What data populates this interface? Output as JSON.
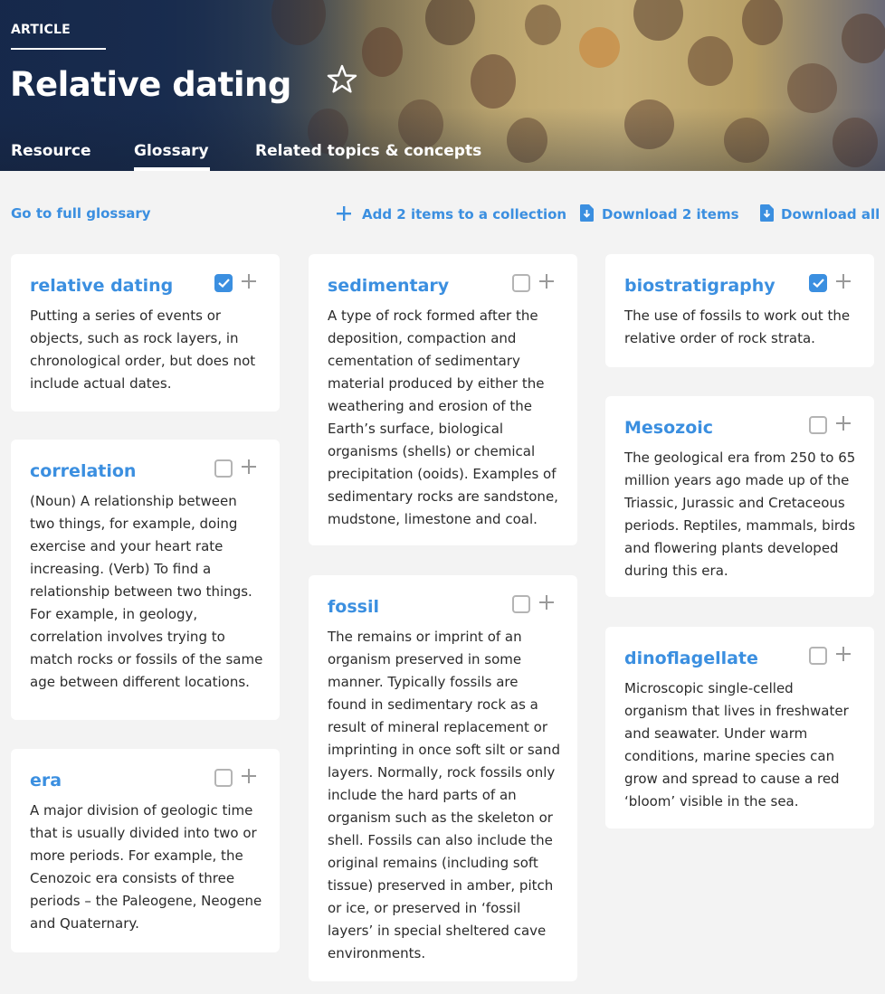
{
  "header": {
    "kicker": "ARTICLE",
    "title": "Relative dating",
    "favorite_icon": "star-outline-icon",
    "tabs": [
      {
        "label": "Resource",
        "active": false
      },
      {
        "label": "Glossary",
        "active": true
      },
      {
        "label": "Related topics & concepts",
        "active": false
      }
    ]
  },
  "toolbar": {
    "full_glossary": "Go to full glossary",
    "add_collection": "Add 2 items to a collection",
    "download_selected": "Download 2 items",
    "download_all": "Download all"
  },
  "colors": {
    "accent": "#3b8fe0",
    "header_dark": "#1a2f52",
    "page_bg": "#f3f3f3"
  },
  "glossary": [
    {
      "term": "relative dating",
      "checked": true,
      "definition": "Putting a series of events or objects, such as rock layers, in chronological order, but does not include actual dates."
    },
    {
      "term": "correlation",
      "checked": false,
      "definition": "(Noun) A relationship between two things, for example, doing exercise and your heart rate increasing. (Verb) To find a relationship between two things. For example, in geology, correlation involves trying to match rocks or fossils of the same age between different locations."
    },
    {
      "term": "era",
      "checked": false,
      "definition": "A major division of geologic time that is usually divided into two or more periods. For example, the Cenozoic era consists of three periods – the Paleogene, Neogene and Quaternary."
    },
    {
      "term": "sedimentary",
      "checked": false,
      "definition": "A type of rock formed after the deposition, compaction and cementation of sedimentary material produced by either the weathering and erosion of the Earth’s surface, biological organisms (shells) or chemical precipitation (ooids). Examples of sedimentary rocks are sandstone, mudstone, limestone and coal."
    },
    {
      "term": "fossil",
      "checked": false,
      "definition": "The remains or imprint of an organism preserved in some manner. Typically fossils are found in sedimentary rock as a result of mineral replacement or imprinting in once soft silt or sand layers. Normally, rock fossils only include the hard parts of an organism such as the skeleton or shell. Fossils can also include the original remains (including soft tissue) preserved in amber, pitch or ice, or preserved in ‘fossil layers’ in special sheltered cave environments."
    },
    {
      "term": "biostratigraphy",
      "checked": true,
      "definition": "The use of fossils to work out the relative order of rock strata."
    },
    {
      "term": "Mesozoic",
      "checked": false,
      "definition": "The geological era from 250 to 65 million years ago made up of the Triassic, Jurassic and Cretaceous periods. Reptiles, mammals, birds and flowering plants developed during this era."
    },
    {
      "term": "dinoflagellate",
      "checked": false,
      "definition": "Microscopic single-celled organism that lives in freshwater and seawater. Under warm conditions, marine species can grow and spread to cause a red ‘bloom’ visible in the sea."
    }
  ]
}
